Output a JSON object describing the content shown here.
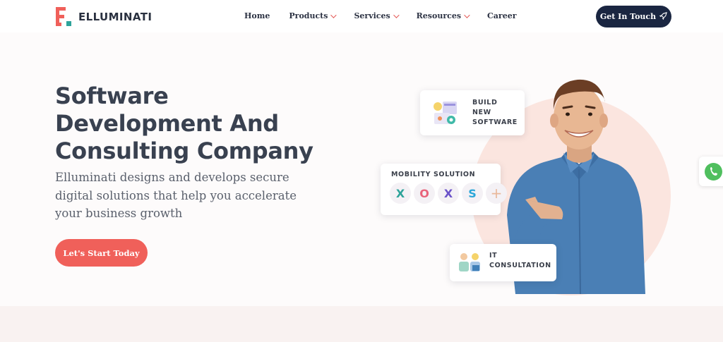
{
  "brand": {
    "name": "ELLUMINATI",
    "accent": "#f0605a",
    "dark": "#1a2641",
    "green": "#2ea39a"
  },
  "nav": {
    "items": [
      {
        "label": "Home",
        "dropdown": false
      },
      {
        "label": "Products",
        "dropdown": true
      },
      {
        "label": "Services",
        "dropdown": true
      },
      {
        "label": "Resources",
        "dropdown": true
      },
      {
        "label": "Career",
        "dropdown": false
      }
    ],
    "cta_label": "Get In Touch",
    "cta_icon": "rocket-icon"
  },
  "hero": {
    "title_lines": [
      "Software",
      "Development And",
      "Consulting Company"
    ],
    "subtitle_lines": [
      "Elluminati designs and develops secure",
      "digital solutions that help you accelerate",
      "your business growth"
    ],
    "button_label": "Let's Start Today"
  },
  "illustration": {
    "cards": {
      "build": [
        "BUILD",
        "NEW",
        "SOFTWARE"
      ],
      "mobility": "MOBILITY SOLUTION",
      "it": [
        "IT",
        "CONSULTATION"
      ]
    },
    "tech_icons": [
      {
        "name": "xamarin-icon",
        "glyph": "X",
        "color": "#2ea39a"
      },
      {
        "name": "ionic-icon",
        "glyph": "O",
        "color": "#e8637a"
      },
      {
        "name": "xcode-icon",
        "glyph": "X",
        "color": "#6b53c9"
      },
      {
        "name": "swift-icon",
        "glyph": "S",
        "color": "#2aa6d8"
      },
      {
        "name": "plus-icon",
        "glyph": "+",
        "color": "#e9b89a"
      }
    ]
  },
  "floating": {
    "whatsapp_icon": "whatsapp-icon"
  }
}
